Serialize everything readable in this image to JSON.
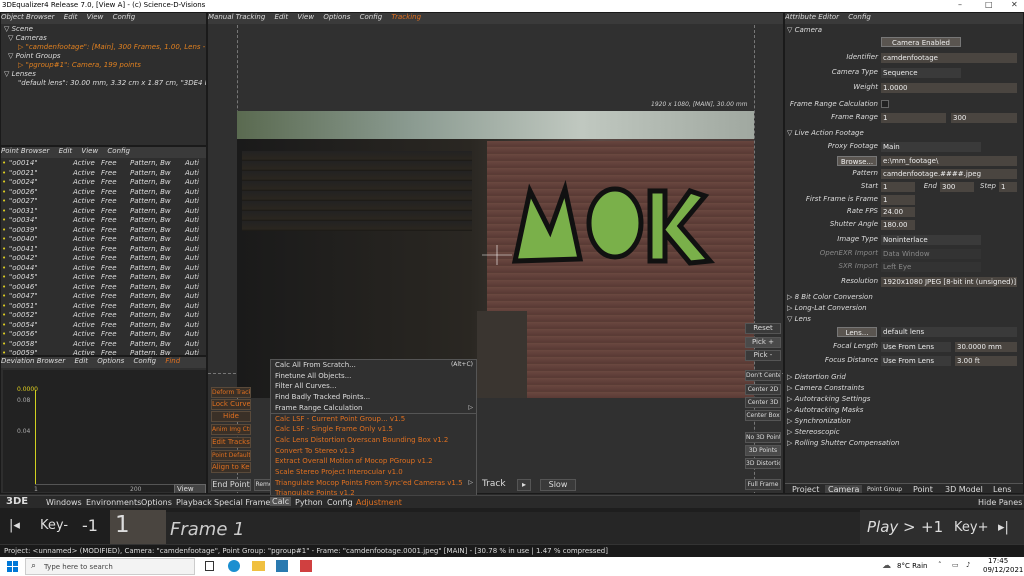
{
  "window": {
    "title": "3DEqualizer4 Release 7.0, [View A] - (c) Science-D-Visions",
    "min": "–",
    "max": "□",
    "close": "✕"
  },
  "object_browser": {
    "menu": [
      "Object Browser",
      "Edit",
      "View",
      "Config"
    ],
    "tree": [
      "▽ Scene",
      "  ▽ Cameras",
      "     ▷ \"camdenfootage\": [Main], 300 Frames, 1.00, Lens ->",
      "  ▽ Point Groups",
      "     ▷ \"pgroup#1\": Camera, 199 points",
      "▽ Lenses",
      "     \"default lens\": 30.00 mm, 3.32 cm x 1.87 cm, \"3DE4 Rad"
    ]
  },
  "point_browser": {
    "menu": [
      "Point Browser",
      "Edit",
      "View",
      "Config"
    ],
    "rows": [
      [
        "\"o0014\"",
        "Active",
        "Free",
        "Pattern, Bw",
        "Auti"
      ],
      [
        "\"o0021\"",
        "Active",
        "Free",
        "Pattern, Bw",
        "Auti"
      ],
      [
        "\"o0024\"",
        "Active",
        "Free",
        "Pattern, Bw",
        "Auti"
      ],
      [
        "\"o0026\"",
        "Active",
        "Free",
        "Pattern, Bw",
        "Auti"
      ],
      [
        "\"o0027\"",
        "Active",
        "Free",
        "Pattern, Bw",
        "Auti"
      ],
      [
        "\"o0031\"",
        "Active",
        "Free",
        "Pattern, Bw",
        "Auti"
      ],
      [
        "\"o0034\"",
        "Active",
        "Free",
        "Pattern, Bw",
        "Auti"
      ],
      [
        "\"o0039\"",
        "Active",
        "Free",
        "Pattern, Bw",
        "Auti"
      ],
      [
        "\"o0040\"",
        "Active",
        "Free",
        "Pattern, Bw",
        "Auti"
      ],
      [
        "\"o0041\"",
        "Active",
        "Free",
        "Pattern, Bw",
        "Auti"
      ],
      [
        "\"o0042\"",
        "Active",
        "Free",
        "Pattern, Bw",
        "Auti"
      ],
      [
        "\"o0044\"",
        "Active",
        "Free",
        "Pattern, Bw",
        "Auti"
      ],
      [
        "\"o0045\"",
        "Active",
        "Free",
        "Pattern, Bw",
        "Auti"
      ],
      [
        "\"o0046\"",
        "Active",
        "Free",
        "Pattern, Bw",
        "Auti"
      ],
      [
        "\"o0047\"",
        "Active",
        "Free",
        "Pattern, Bw",
        "Auti"
      ],
      [
        "\"o0051\"",
        "Active",
        "Free",
        "Pattern, Bw",
        "Auti"
      ],
      [
        "\"o0052\"",
        "Active",
        "Free",
        "Pattern, Bw",
        "Auti"
      ],
      [
        "\"o0054\"",
        "Active",
        "Free",
        "Pattern, Bw",
        "Auti"
      ],
      [
        "\"o0056\"",
        "Active",
        "Free",
        "Pattern, Bw",
        "Auti"
      ],
      [
        "\"o0058\"",
        "Active",
        "Free",
        "Pattern, Bw",
        "Auti"
      ],
      [
        "\"o0059\"",
        "Active",
        "Free",
        "Pattern, Bw",
        "Auti"
      ]
    ]
  },
  "deviation_browser": {
    "menu": [
      "Deviation Browser",
      "Edit",
      "Options",
      "Config",
      "Find"
    ],
    "y_top": "0.0000",
    "y_label": "0.08",
    "y_label2": "0.04",
    "x_ticks": [
      "1",
      "200"
    ],
    "view_all": "View All"
  },
  "manual_tracking": {
    "menu": [
      "Manual Tracking",
      "Edit",
      "View",
      "Options",
      "Config",
      "Tracking"
    ],
    "info": "1920 x 1080, [MAIN], 30.00 mm",
    "left_buttons": [
      "Deform Track",
      "Lock Curve",
      "Hide",
      "Anim Img Ctrls",
      "Edit Tracks",
      "Point Defaults",
      "Align to Key"
    ],
    "end_point": "End Point",
    "remove": "Remo",
    "right_buttons": [
      "Reset",
      "Pick +",
      "Pick -",
      "Don't Center",
      "Center 2D",
      "Center 3D",
      "Center Box",
      "No 3D Points",
      "3D Points",
      "3D Distortion",
      "Full Frame"
    ],
    "track": "Track",
    "slow": "Slow",
    "play_small": "▸"
  },
  "calc_menu": {
    "items": [
      {
        "label": "Calc All From Scratch...",
        "shortcut": "(Alt+C)",
        "orange": false
      },
      {
        "label": "Finetune All Objects...",
        "shortcut": "",
        "orange": false
      },
      {
        "label": "Filter All Curves...",
        "shortcut": "",
        "orange": false
      },
      {
        "label": "Find Badly Tracked Points...",
        "shortcut": "",
        "orange": false
      },
      {
        "label": "Frame Range Calculation",
        "shortcut": "▷",
        "orange": false
      },
      {
        "label": "Calc LSF - Current Point Group...  v1.5",
        "shortcut": "",
        "orange": true
      },
      {
        "label": "Calc LSF - Single Frame Only  v1.5",
        "shortcut": "",
        "orange": true
      },
      {
        "label": "Calc Lens Distortion Overscan Bounding Box  v1.2",
        "shortcut": "",
        "orange": true
      },
      {
        "label": "Convert To Stereo  v1.3",
        "shortcut": "",
        "orange": true
      },
      {
        "label": "Extract Overall Motion of Mocop PGroup  v1.2",
        "shortcut": "",
        "orange": true
      },
      {
        "label": "Scale Stereo Project Interocular  v1.0",
        "shortcut": "",
        "orange": true
      },
      {
        "label": "Triangulate Mocop Points From Sync'ed Cameras  v1.5",
        "shortcut": "▷",
        "orange": true
      },
      {
        "label": "Triangulate Points  v1.2",
        "shortcut": "",
        "orange": true
      }
    ]
  },
  "attribute_editor": {
    "menu": [
      "Attribute Editor",
      "Config"
    ],
    "camera_section": "▽ Camera",
    "camera_enabled": "Camera Enabled",
    "identifier_lbl": "Identifier",
    "identifier": "camdenfootage",
    "camera_type_lbl": "Camera Type",
    "camera_type": "Sequence",
    "weight_lbl": "Weight",
    "weight": "1.0000",
    "frc_lbl": "Frame Range Calculation",
    "frame_range_lbl": "Frame Range",
    "frame_range_start": "1",
    "frame_range_end": "300",
    "lao_section": "▽ Live Action Footage",
    "proxy_lbl": "Proxy Footage",
    "proxy": "Main",
    "browse": "Browse...",
    "path": "e:\\mm_footage\\",
    "pattern_lbl": "Pattern",
    "pattern": "camdenfootage.####.jpeg",
    "start_lbl": "Start",
    "start": "1",
    "end_lbl": "End",
    "end": "300",
    "step_lbl": "Step",
    "step": "1",
    "ffif_lbl": "First Frame is Frame",
    "ffif": "1",
    "fps_lbl": "Rate FPS",
    "fps": "24.00",
    "shutter_lbl": "Shutter Angle",
    "shutter": "180.00",
    "imgtype_lbl": "Image Type",
    "imgtype": "Noninterlace",
    "openexr_lbl": "OpenEXR Import",
    "openexr": "Data Window",
    "sxr_lbl": "SXR Import",
    "sxr": "Left Eye",
    "res_lbl": "Resolution",
    "res": "1920x1080 JPEG [8-bit int (unsigned)]",
    "s_8bit": "▷ 8 Bit Color Conversion",
    "s_longlat": "▷ Long-Lat Conversion",
    "lens_section": "▽ Lens",
    "lens_btn": "Lens...",
    "lens_name": "default lens",
    "focal_lbl": "Focal Length",
    "focal_mode": "Use From Lens",
    "focal": "30.0000 mm",
    "focus_lbl": "Focus Distance",
    "focus_mode": "Use From Lens",
    "focus": "3.00 ft",
    "collapsed": [
      "▷ Distortion Grid",
      "▷ Camera Constraints",
      "▷ Autotracking Settings",
      "▷ Autotracking Masks",
      "▷ Synchronization",
      "▷ Stereoscopic",
      "▷ Rolling Shutter Compensation"
    ],
    "tabs": [
      "Project",
      "Camera",
      "Point Group",
      "Point",
      "3D Model",
      "Lens"
    ]
  },
  "bottom_menu": {
    "logo": "3DE",
    "items": [
      "Windows",
      "Environments",
      "Options",
      "Playback",
      "Special Frames",
      "Calc",
      "Python",
      "Config",
      "Adjustment"
    ],
    "hide_panes": "Hide Panes"
  },
  "timeline": {
    "prev": "|◂",
    "key_minus": "Key-",
    "minus1": "-1",
    "frame_num": "1",
    "frame_text": "Frame 1",
    "play": "Play >",
    "plus1": "+1",
    "key_plus": "Key+",
    "next": "▸|"
  },
  "status": "Project: <unnamed> (MODIFIED), Camera: \"camdenfootage\", Point Group: \"pgroup#1\" - Frame: \"camdenfootage.0001.jpeg\"  [MAIN]  - [30.78 % in use | 1.47 % compressed]",
  "taskbar": {
    "search_placeholder": "Type here to search",
    "weather": "8°C Rain",
    "time": "17:45",
    "date": "09/12/2021"
  }
}
